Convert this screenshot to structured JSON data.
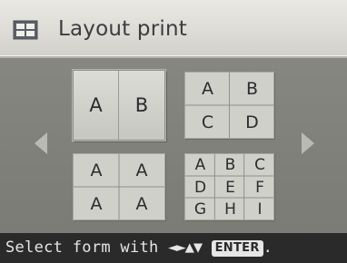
{
  "header": {
    "title": "Layout print",
    "icon": "layout-grid-icon"
  },
  "navigation": {
    "prev_icon": "arrow-left-icon",
    "next_icon": "arrow-right-icon"
  },
  "layouts": [
    {
      "id": "2-up",
      "selected": true,
      "cells": [
        "A",
        "B"
      ]
    },
    {
      "id": "4-up",
      "selected": false,
      "cells": [
        "A",
        "B",
        "C",
        "D"
      ]
    },
    {
      "id": "4-same",
      "selected": false,
      "cells": [
        "A",
        "A",
        "A",
        "A"
      ]
    },
    {
      "id": "9-up",
      "selected": false,
      "cells": [
        "A",
        "B",
        "C",
        "D",
        "E",
        "F",
        "G",
        "H",
        "I"
      ]
    }
  ],
  "footer": {
    "text": "Select form with",
    "arrows": "◄►▲▼",
    "enter_label": "ENTER",
    "end": "."
  },
  "colors": {
    "background": "#7f827a",
    "header": "#dedcd6",
    "footer": "#2a2a2a",
    "tile": "#cfd0ca"
  }
}
